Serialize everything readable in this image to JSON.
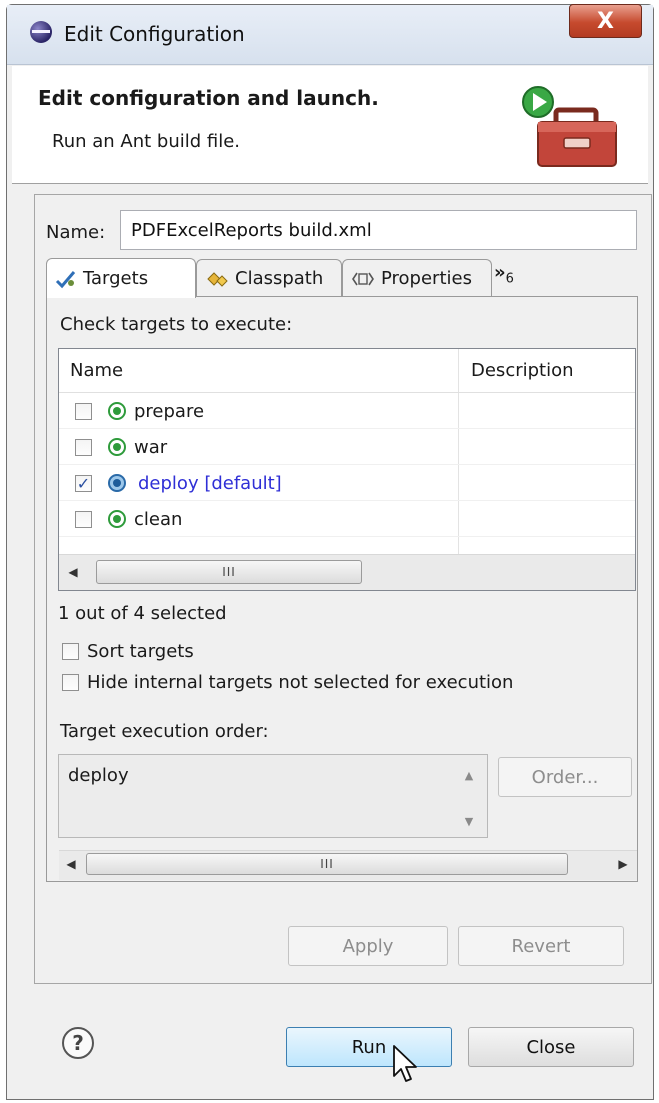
{
  "window": {
    "title": "Edit Configuration",
    "close_glyph": "X"
  },
  "header": {
    "title": "Edit configuration and launch.",
    "subtitle": "Run an Ant build file.",
    "icon": "ant-toolbox-run-icon"
  },
  "config": {
    "name_label": "Name:",
    "name_value": "PDFExcelReports build.xml"
  },
  "tabs": [
    {
      "label": "Targets",
      "icon": "targets-icon",
      "active": true
    },
    {
      "label": "Classpath",
      "icon": "classpath-icon",
      "active": false
    },
    {
      "label": "Properties",
      "icon": "properties-icon",
      "active": false
    }
  ],
  "tab_overflow": {
    "glyph": "»",
    "count": "6"
  },
  "targets": {
    "instruction": "Check targets to execute:",
    "columns": [
      "Name",
      "Description"
    ],
    "rows": [
      {
        "name": "prepare",
        "description": "",
        "checked": false,
        "default": false
      },
      {
        "name": "war",
        "description": "",
        "checked": false,
        "default": false
      },
      {
        "name": "deploy [default]",
        "description": "",
        "checked": true,
        "default": true
      },
      {
        "name": "clean",
        "description": "",
        "checked": false,
        "default": false
      }
    ],
    "scroll_thumb": "III",
    "selection_status": "1 out of 4 selected"
  },
  "options": {
    "sort_targets": "Sort targets",
    "hide_internal": "Hide internal targets not selected for execution"
  },
  "execution_order": {
    "label": "Target execution order:",
    "items": [
      "deploy"
    ],
    "order_button": "Order...",
    "scroll_thumb": "III"
  },
  "buttons": {
    "apply": "Apply",
    "revert": "Revert",
    "run": "Run",
    "close": "Close",
    "help": "?"
  },
  "colors": {
    "default_target": "#2f2fd6",
    "close_button": "#c64a2e",
    "run_button": "#bee6fd"
  }
}
